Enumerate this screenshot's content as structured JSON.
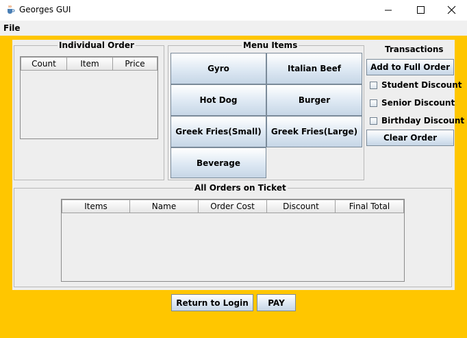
{
  "window": {
    "title": "Georges GUI"
  },
  "menu": {
    "file": "File"
  },
  "individual_order": {
    "title": "Individual Order",
    "columns": [
      "Count",
      "Item",
      "Price"
    ]
  },
  "menu_items": {
    "title": "Menu Items",
    "buttons": [
      "Gyro",
      "Italian Beef",
      "Hot Dog",
      "Burger",
      "Greek Fries(Small)",
      "Greek Fries(Large)",
      "Beverage"
    ]
  },
  "transactions": {
    "title": "Transactions",
    "add_label": "Add to Full Order",
    "discounts": [
      "Student Discount",
      "Senior Discount",
      "Birthday Discount"
    ],
    "clear_label": "Clear Order"
  },
  "all_orders": {
    "title": "All Orders on Ticket",
    "columns": [
      "Items",
      "Name",
      "Order Cost",
      "Discount",
      "Final Total"
    ]
  },
  "footer": {
    "return_label": "Return to Login",
    "pay_label": "PAY"
  },
  "colors": {
    "background": "#ffc600",
    "panel": "#eeeeee"
  },
  "icons": {
    "app": "java-cup-icon",
    "minimize": "minimize-icon",
    "maximize": "maximize-icon",
    "close": "close-icon"
  }
}
